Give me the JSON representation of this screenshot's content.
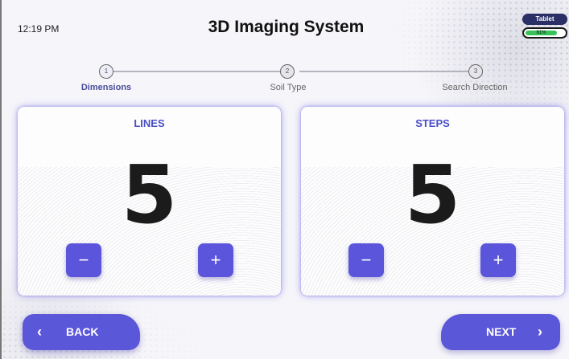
{
  "status": {
    "time": "12:19 PM"
  },
  "header": {
    "title": "3D Imaging System"
  },
  "device": {
    "label": "Tablet",
    "battery_text": "81%",
    "battery_level": 0.81
  },
  "stepper": {
    "steps": [
      {
        "number": "1",
        "label": "Dimensions",
        "active": true
      },
      {
        "number": "2",
        "label": "Soil Type",
        "active": false
      },
      {
        "number": "3",
        "label": "Search Direction",
        "active": false
      }
    ]
  },
  "cards": [
    {
      "title": "LINES",
      "value": "5",
      "minus": "−",
      "plus": "+"
    },
    {
      "title": "STEPS",
      "value": "5",
      "minus": "−",
      "plus": "+"
    }
  ],
  "footer": {
    "back_label": "BACK",
    "back_icon": "‹",
    "next_label": "NEXT",
    "next_icon": "›"
  },
  "colors": {
    "accent": "#5a55db",
    "title_blue": "#4a4fc4",
    "battery_green": "#37c25a"
  }
}
